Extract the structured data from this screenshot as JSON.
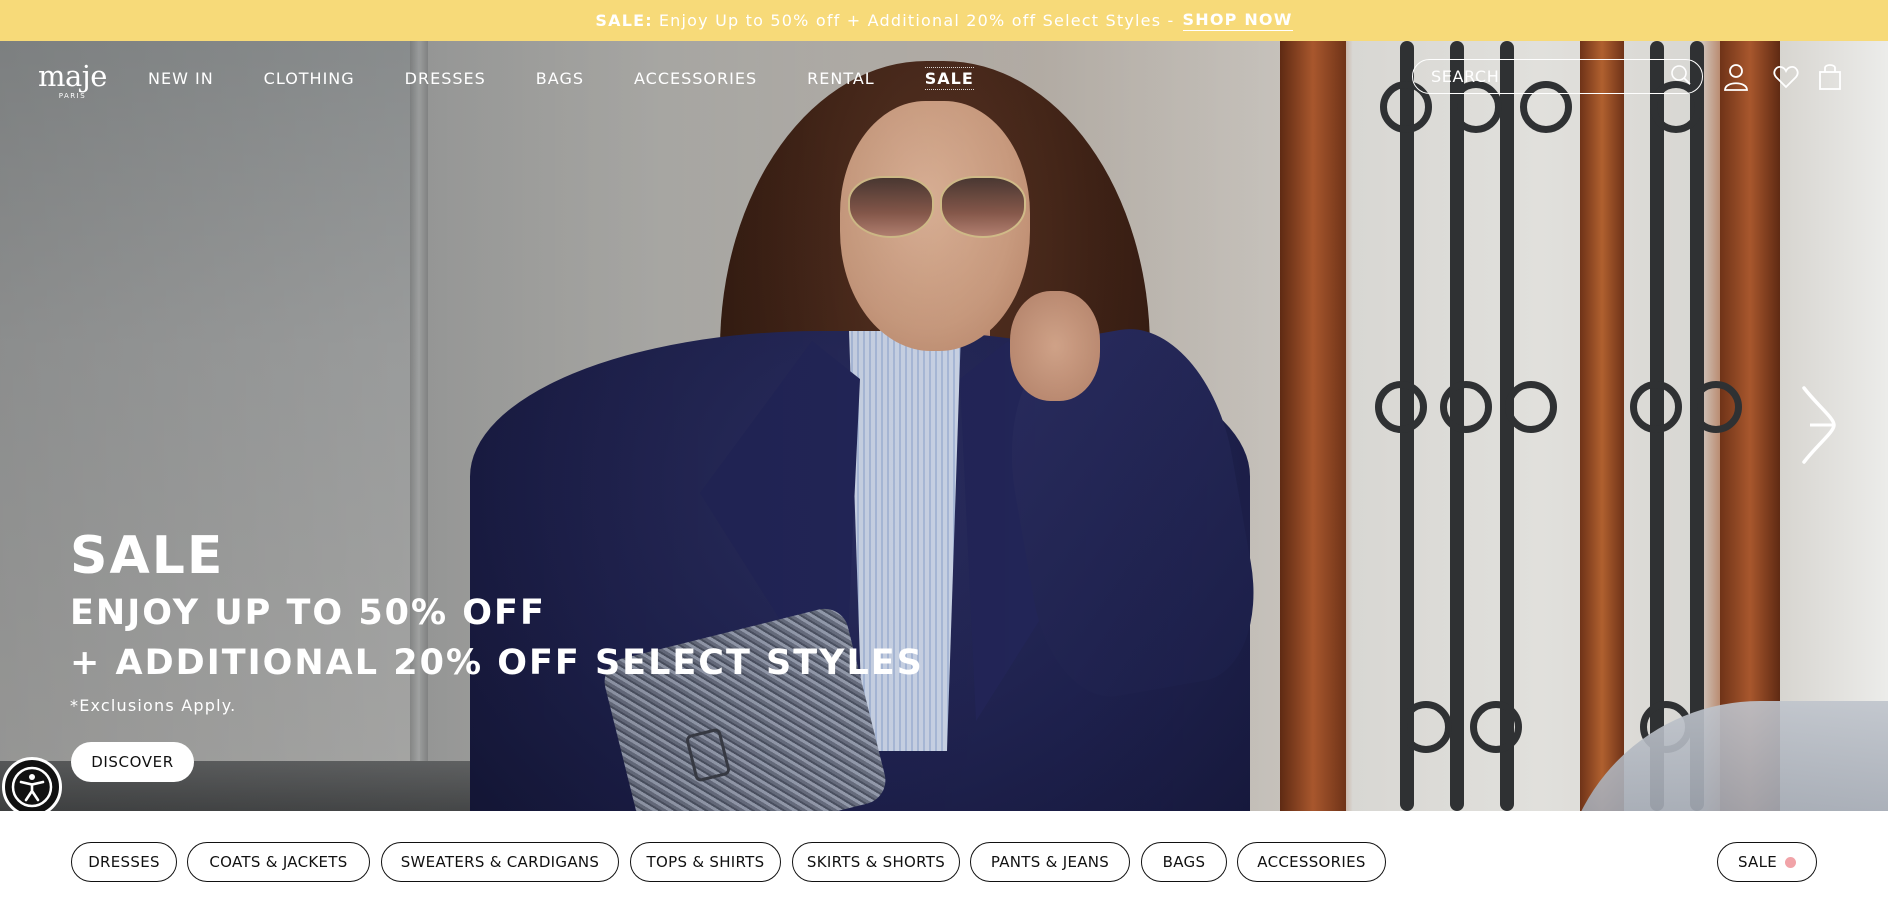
{
  "promo": {
    "label": "SALE:",
    "text": "Enjoy Up to 50% off + Additional 20% off Select Styles -",
    "cta": "SHOP NOW"
  },
  "header": {
    "logo": "maje",
    "logo_sub": "PARIS",
    "nav": [
      {
        "label": "NEW IN"
      },
      {
        "label": "CLOTHING"
      },
      {
        "label": "DRESSES"
      },
      {
        "label": "BAGS"
      },
      {
        "label": "ACCESSORIES"
      },
      {
        "label": "RENTAL"
      },
      {
        "label": "SALE"
      }
    ],
    "search_placeholder": "SEARCH",
    "icons": [
      "search-icon",
      "account-icon",
      "wishlist-heart-icon",
      "shopping-bag-icon"
    ]
  },
  "hero": {
    "title": "SALE",
    "line1": "ENJOY UP TO 50% OFF",
    "line2": "+ ADDITIONAL 20% OFF SELECT STYLES",
    "note": "*Exclusions Apply.",
    "cta": "DISCOVER",
    "next_icon": "chevron-right-icon",
    "accessibility_icon": "accessibility-icon"
  },
  "categories": [
    {
      "label": "DRESSES"
    },
    {
      "label": "COATS & JACKETS"
    },
    {
      "label": "SWEATERS & CARDIGANS"
    },
    {
      "label": "TOPS & SHIRTS"
    },
    {
      "label": "SKIRTS & SHORTS"
    },
    {
      "label": "PANTS & JEANS"
    },
    {
      "label": "BAGS"
    },
    {
      "label": "ACCESSORIES"
    },
    {
      "label": "SALE"
    }
  ],
  "colors": {
    "promo_bg": "#f7da79",
    "sale_dot": "#f1a3a8"
  }
}
